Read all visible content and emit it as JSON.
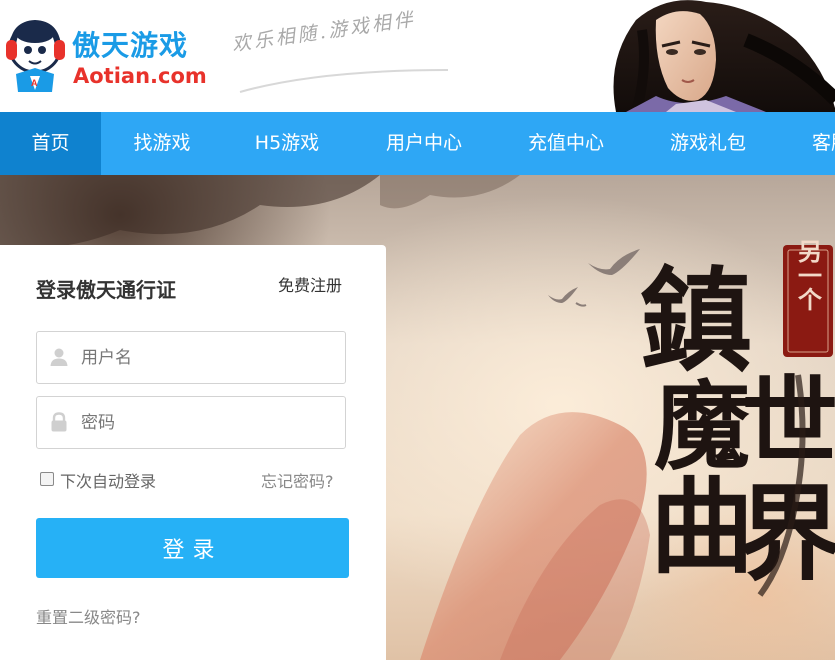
{
  "brand": {
    "name_cn": "傲天游戏",
    "name_en": "Aotian.com",
    "slogan": "欢乐相随.游戏相伴",
    "mascot_icon": "headphone-mascot-icon",
    "color_primary": "#1a9be6",
    "color_secondary": "#e8322b"
  },
  "nav": {
    "items": [
      {
        "label": "首页",
        "active": true
      },
      {
        "label": "找游戏"
      },
      {
        "label": "H5游戏"
      },
      {
        "label": "用户中心"
      },
      {
        "label": "充值中心"
      },
      {
        "label": "游戏礼包"
      },
      {
        "label": "客服"
      }
    ],
    "bg_color": "#2ea7f5",
    "active_color": "#0f82cf"
  },
  "banner": {
    "calligraphy_main": [
      "鎮",
      "魔",
      "曲"
    ],
    "calligraphy_side": [
      "世",
      "界"
    ],
    "seal_text": "另一个"
  },
  "login": {
    "title": "登录傲天通行证",
    "register_label": "免费注册",
    "username_placeholder": "用户名",
    "password_placeholder": "密码",
    "username_icon": "user-icon",
    "password_icon": "lock-icon",
    "remember_label": "下次自动登录",
    "forgot_label": "忘记密码?",
    "submit_label": "登录",
    "reset_label": "重置二级密码?",
    "button_color": "#26b1f6"
  }
}
